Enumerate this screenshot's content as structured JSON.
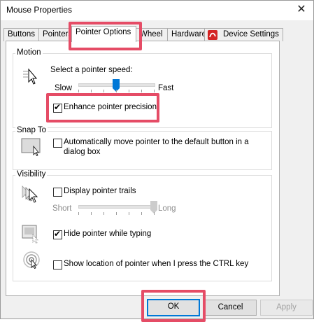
{
  "window": {
    "title": "Mouse Properties",
    "close_glyph": "✕"
  },
  "tabs": [
    {
      "label": "Buttons"
    },
    {
      "label": "Pointers"
    },
    {
      "label": "Pointer Options"
    },
    {
      "label": "Wheel"
    },
    {
      "label": "Hardware"
    },
    {
      "label": "Device Settings"
    }
  ],
  "motion": {
    "group_label": "Motion",
    "speed_label": "Select a pointer speed:",
    "slow_label": "Slow",
    "fast_label": "Fast",
    "speed_level": 0.5,
    "precision_label": "Enhance pointer precision",
    "precision_checked": true
  },
  "snap": {
    "group_label": "Snap To",
    "label_line1": "Automatically move pointer to the default button in a",
    "label_line2": "dialog box",
    "checked": false
  },
  "visibility": {
    "group_label": "Visibility",
    "trails_label": "Display pointer trails",
    "trails_checked": false,
    "short_label": "Short",
    "long_label": "Long",
    "trail_level": 1.0,
    "hide_label": "Hide pointer while typing",
    "hide_checked": true,
    "ctrl_label": "Show location of pointer when I press the CTRL key",
    "ctrl_checked": false
  },
  "buttons": {
    "ok": "OK",
    "cancel": "Cancel",
    "apply": "Apply"
  },
  "colors": {
    "highlight": "#e54c66",
    "accent": "#0078d7",
    "device_icon": "#d42323"
  }
}
